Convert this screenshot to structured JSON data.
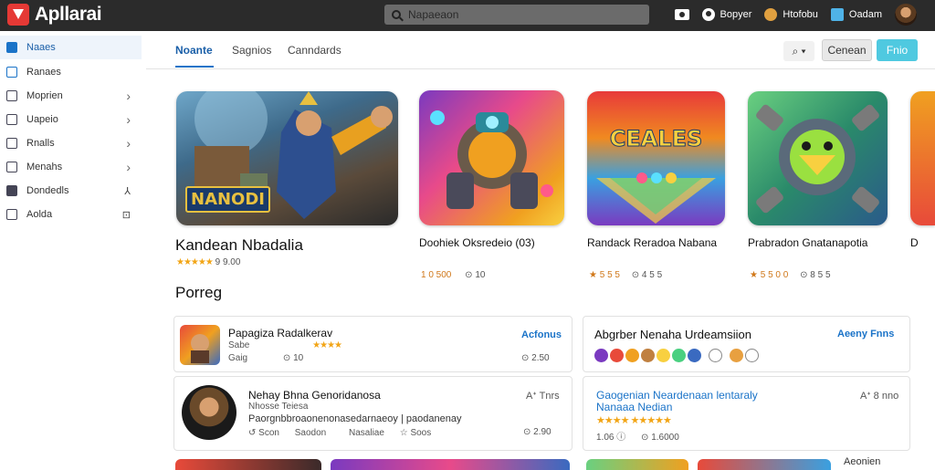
{
  "app": {
    "title": "Apllarai"
  },
  "search": {
    "placeholder": "Napaeaon"
  },
  "topbar": {
    "items": [
      {
        "label": "Bopyer"
      },
      {
        "label": "Htofobu"
      },
      {
        "label": "Oadam"
      }
    ]
  },
  "sidebar": {
    "items": [
      {
        "label": "Naaes"
      },
      {
        "label": "Ranaes"
      },
      {
        "label": "Moprien"
      },
      {
        "label": "Uapeio"
      },
      {
        "label": "Rnalls"
      },
      {
        "label": "Menahs"
      },
      {
        "label": "Dondedls"
      },
      {
        "label": "Aolda"
      }
    ]
  },
  "tabs": [
    {
      "label": "Noante"
    },
    {
      "label": "Sagnios"
    },
    {
      "label": "Canndards"
    }
  ],
  "toolbar": {
    "filter_label": "⌕ ▾",
    "cancel_label": "Cenean",
    "primary_label": "Fnio"
  },
  "featured": [
    {
      "title": "Kandean Nbadalia",
      "banner": "NANODI",
      "rating": "★★★★★",
      "meta": "9 9.00"
    },
    {
      "title": "Doohiek Oksredeio (03)",
      "rating": "",
      "meta": "1 0 500",
      "meta2": "⊙ 10"
    },
    {
      "title": "Randack Reradoa Nabana",
      "banner": "CEALES",
      "rating": "",
      "meta": "★ 5 5 5",
      "meta2": "⊙ 4 5 5"
    },
    {
      "title": "Prabradon Gnatanapotia",
      "rating": "",
      "meta": "★ 5 5 0 0",
      "meta2": "⊙ 8 5 5"
    },
    {
      "title": "D"
    }
  ],
  "section": {
    "heading": "Porreg"
  },
  "list": [
    {
      "title": "Papagiza Radalkerav",
      "sub": "Sabe",
      "rating": "★★★★",
      "meta1": "Gaig",
      "meta2": "⊙ 10",
      "link": "Acfonus",
      "stat": "⊙ 2.50"
    },
    {
      "title": "Abgrber Nenaha Urdeamsiion",
      "link": "Aeeny Fnns"
    },
    {
      "title": "Nehay Bhna Genoridanosa",
      "sub": "Nhosse Teiesa",
      "desc": "Paorgnbbroaonenonasedarnaeoy | paodanenay",
      "meta1": "↺ Scon",
      "meta2": "Saodon",
      "meta3": "Nasaliae",
      "meta4": "☆ Soos",
      "link": "Aᐩ Tnrs",
      "stat": "⊙ 2.90"
    },
    {
      "title": "Gaogenian Neardenaan lentaraly",
      "title2": "Nanaaa Nedian",
      "rating": "★★★★ ★★★★★",
      "meta1": "1.06 ⓘ",
      "meta2": "⊙ 1.6000",
      "link": "Aᐩ 8 nno"
    }
  ],
  "bottom": {
    "label": "Aeonien"
  },
  "colors": {
    "accent": "#1a73c8",
    "primary_button": "#4fc9e0",
    "star": "#f2a516",
    "topbar": "#2b2b2b"
  }
}
